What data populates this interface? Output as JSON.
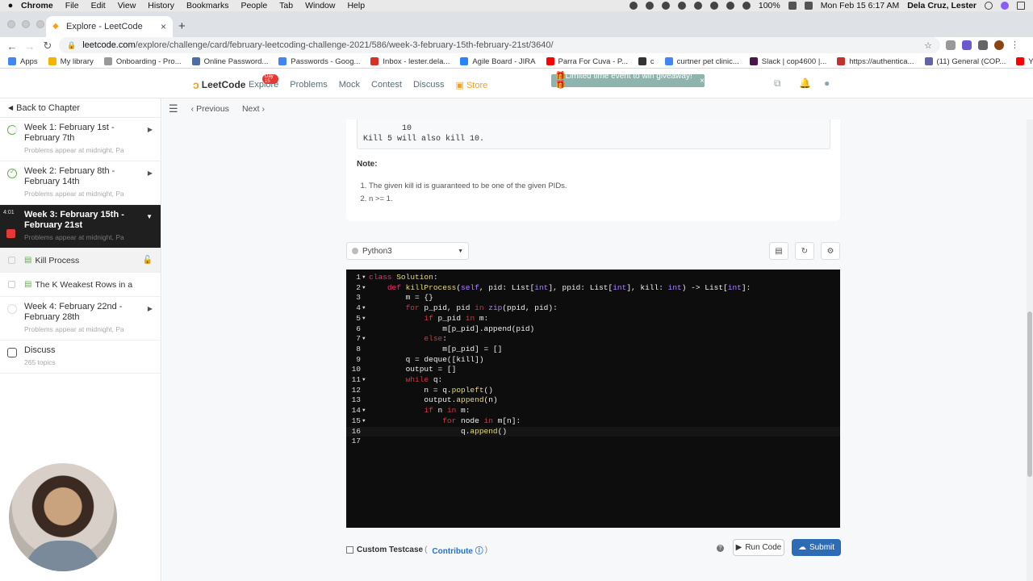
{
  "menubar": {
    "items": [
      "Chrome",
      "File",
      "Edit",
      "View",
      "History",
      "Bookmarks",
      "People",
      "Tab",
      "Window",
      "Help"
    ],
    "battery": "100%",
    "datetime": "Mon Feb 15  6:17 AM",
    "user": "Dela Cruz, Lester"
  },
  "tab": {
    "title": "Explore - LeetCode"
  },
  "address": {
    "host": "leetcode.com",
    "path": "/explore/challenge/card/february-leetcoding-challenge-2021/586/week-3-february-15th-february-21st/3640/"
  },
  "bookmarks": [
    {
      "label": "Apps",
      "color": "#4285f4"
    },
    {
      "label": "My library",
      "color": "#f4b400"
    },
    {
      "label": "Onboarding - Pro...",
      "color": "#999999"
    },
    {
      "label": "Online Password...",
      "color": "#4a6fa5"
    },
    {
      "label": "Passwords - Goog...",
      "color": "#4285f4"
    },
    {
      "label": "Inbox - lester.dela...",
      "color": "#d93025"
    },
    {
      "label": "Agile Board - JIRA",
      "color": "#2684ff"
    },
    {
      "label": "Parra For Cuva - P...",
      "color": "#ff0000"
    },
    {
      "label": "c",
      "color": "#333333"
    },
    {
      "label": "curtner pet clinic...",
      "color": "#4285f4"
    },
    {
      "label": "Slack | cop4600 |...",
      "color": "#4a154b"
    },
    {
      "label": "https://authentica...",
      "color": "#c4302b"
    },
    {
      "label": "(11) General (COP...",
      "color": "#6264a7"
    },
    {
      "label": "YouTube",
      "color": "#ff0000"
    }
  ],
  "lcnav": {
    "logo": "LeetCode",
    "links": [
      "Explore",
      "Problems",
      "Mock",
      "Contest",
      "Discuss",
      "Store"
    ],
    "badge": "Day 15",
    "promo": "🎁Limited time event to win giveaway!🎁"
  },
  "sidebar": {
    "back": "Back to Chapter",
    "weeks": [
      {
        "title": "Week 1: February 1st - February 7th",
        "sub": "Problems appear at midnight, Pa"
      },
      {
        "title": "Week 2: February 8th - February 14th",
        "sub": "Problems appear at midnight, Pa"
      },
      {
        "title": "Week 3: February 15th - February 21st",
        "sub": "Problems appear at midnight, Pa",
        "timer": "4:01"
      },
      {
        "title": "Week 4: February 22nd - February 28th",
        "sub": "Problems appear at midnight, Pa"
      }
    ],
    "problems": [
      "Kill Process",
      "The K Weakest Rows in a ..."
    ],
    "discuss": {
      "title": "Discuss",
      "sub": "265 topics"
    }
  },
  "main": {
    "prev": "Previous",
    "next": "Next",
    "example_tail": "        10\nKill 5 will also kill 10.",
    "note_label": "Note:",
    "notes": [
      "The given kill id is guaranteed to be one of the given PIDs.",
      "n >= 1."
    ],
    "language": "Python3",
    "custom_testcase": "Custom Testcase",
    "contribute": "Contribute",
    "run_code": "Run Code",
    "submit": "Submit"
  },
  "code_lines": [
    "1",
    "2",
    "3",
    "4",
    "5",
    "6",
    "7",
    "8",
    "9",
    "10",
    "11",
    "12",
    "13",
    "14",
    "15",
    "16",
    "17"
  ]
}
